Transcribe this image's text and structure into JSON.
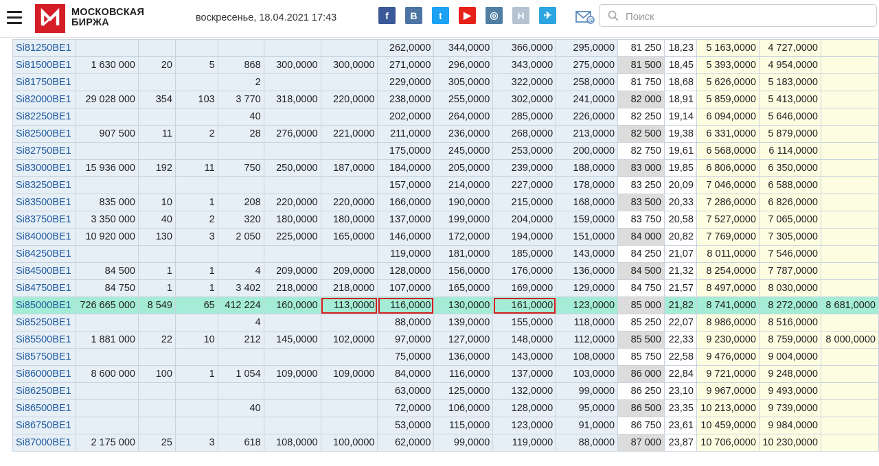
{
  "header": {
    "logo_text": "МОСКОВСКАЯ БИРЖА",
    "datetime": "воскресенье, 18.04.2021 17:43",
    "search_placeholder": "Поиск",
    "social": [
      {
        "name": "facebook-icon",
        "glyph": "f",
        "color": "#3b5998"
      },
      {
        "name": "vkontakte-icon",
        "glyph": "B",
        "color": "#4c75a3"
      },
      {
        "name": "twitter-icon",
        "glyph": "t",
        "color": "#1da1f2"
      },
      {
        "name": "youtube-icon",
        "glyph": "▶",
        "color": "#e62117"
      },
      {
        "name": "instagram-icon",
        "glyph": "◎",
        "color": "#517fa4"
      },
      {
        "name": "newsletter-h-icon",
        "glyph": "H",
        "color": "#b4c3cf"
      },
      {
        "name": "telegram-icon",
        "glyph": "✈",
        "color": "#2ca5e0"
      }
    ]
  },
  "table": {
    "rows": [
      {
        "c": [
          "Si81250BE1",
          "",
          "",
          "",
          "",
          "",
          "",
          "262,0000",
          "344,0000",
          "366,0000",
          "295,0000",
          "81 250",
          "18,23",
          "5 163,0000",
          "4 727,0000",
          ""
        ],
        "strong": false
      },
      {
        "c": [
          "Si81500BE1",
          "1 630 000",
          "20",
          "5",
          "868",
          "300,0000",
          "300,0000",
          "271,0000",
          "296,0000",
          "343,0000",
          "275,0000",
          "81 500",
          "18,45",
          "5 393,0000",
          "4 954,0000",
          ""
        ],
        "strong": true
      },
      {
        "c": [
          "Si81750BE1",
          "",
          "",
          "",
          "2",
          "",
          "",
          "229,0000",
          "305,0000",
          "322,0000",
          "258,0000",
          "81 750",
          "18,68",
          "5 626,0000",
          "5 183,0000",
          ""
        ],
        "strong": false
      },
      {
        "c": [
          "Si82000BE1",
          "29 028 000",
          "354",
          "103",
          "3 770",
          "318,0000",
          "220,0000",
          "238,0000",
          "255,0000",
          "302,0000",
          "241,0000",
          "82 000",
          "18,91",
          "5 859,0000",
          "5 413,0000",
          ""
        ],
        "strong": true
      },
      {
        "c": [
          "Si82250BE1",
          "",
          "",
          "",
          "40",
          "",
          "",
          "202,0000",
          "264,0000",
          "285,0000",
          "226,0000",
          "82 250",
          "19,14",
          "6 094,0000",
          "5 646,0000",
          ""
        ],
        "strong": false
      },
      {
        "c": [
          "Si82500BE1",
          "907 500",
          "11",
          "2",
          "28",
          "276,0000",
          "221,0000",
          "211,0000",
          "236,0000",
          "268,0000",
          "213,0000",
          "82 500",
          "19,38",
          "6 331,0000",
          "5 879,0000",
          ""
        ],
        "strong": true
      },
      {
        "c": [
          "Si82750BE1",
          "",
          "",
          "",
          "",
          "",
          "",
          "175,0000",
          "245,0000",
          "253,0000",
          "200,0000",
          "82 750",
          "19,61",
          "6 568,0000",
          "6 114,0000",
          ""
        ],
        "strong": false
      },
      {
        "c": [
          "Si83000BE1",
          "15 936 000",
          "192",
          "11",
          "750",
          "250,0000",
          "187,0000",
          "184,0000",
          "205,0000",
          "239,0000",
          "188,0000",
          "83 000",
          "19,85",
          "6 806,0000",
          "6 350,0000",
          ""
        ],
        "strong": true
      },
      {
        "c": [
          "Si83250BE1",
          "",
          "",
          "",
          "",
          "",
          "",
          "157,0000",
          "214,0000",
          "227,0000",
          "178,0000",
          "83 250",
          "20,09",
          "7 046,0000",
          "6 588,0000",
          ""
        ],
        "strong": false
      },
      {
        "c": [
          "Si83500BE1",
          "835 000",
          "10",
          "1",
          "208",
          "220,0000",
          "220,0000",
          "166,0000",
          "190,0000",
          "215,0000",
          "168,0000",
          "83 500",
          "20,33",
          "7 286,0000",
          "6 826,0000",
          ""
        ],
        "strong": true
      },
      {
        "c": [
          "Si83750BE1",
          "3 350 000",
          "40",
          "2",
          "320",
          "180,0000",
          "180,0000",
          "137,0000",
          "199,0000",
          "204,0000",
          "159,0000",
          "83 750",
          "20,58",
          "7 527,0000",
          "7 065,0000",
          ""
        ],
        "strong": false
      },
      {
        "c": [
          "Si84000BE1",
          "10 920 000",
          "130",
          "3",
          "2 050",
          "225,0000",
          "165,0000",
          "146,0000",
          "172,0000",
          "194,0000",
          "151,0000",
          "84 000",
          "20,82",
          "7 769,0000",
          "7 305,0000",
          ""
        ],
        "strong": true
      },
      {
        "c": [
          "Si84250BE1",
          "",
          "",
          "",
          "",
          "",
          "",
          "119,0000",
          "181,0000",
          "185,0000",
          "143,0000",
          "84 250",
          "21,07",
          "8 011,0000",
          "7 546,0000",
          ""
        ],
        "strong": false
      },
      {
        "c": [
          "Si84500BE1",
          "84 500",
          "1",
          "1",
          "4",
          "209,0000",
          "209,0000",
          "128,0000",
          "156,0000",
          "176,0000",
          "136,0000",
          "84 500",
          "21,32",
          "8 254,0000",
          "7 787,0000",
          ""
        ],
        "strong": true
      },
      {
        "c": [
          "Si84750BE1",
          "84 750",
          "1",
          "1",
          "3 402",
          "218,0000",
          "218,0000",
          "107,0000",
          "165,0000",
          "169,0000",
          "129,0000",
          "84 750",
          "21,57",
          "8 497,0000",
          "8 030,0000",
          ""
        ],
        "strong": false
      },
      {
        "c": [
          "Si85000BE1",
          "726 665 000",
          "8 549",
          "65",
          "412 224",
          "160,0000",
          "113,0000",
          "116,0000",
          "130,0000",
          "161,0000",
          "123,0000",
          "85 000",
          "21,82",
          "8 741,0000",
          "8 272,0000",
          "8 681,0000"
        ],
        "strong": true,
        "highlight": true,
        "boxed": [
          6,
          7,
          9
        ]
      },
      {
        "c": [
          "Si85250BE1",
          "",
          "",
          "",
          "4",
          "",
          "",
          "88,0000",
          "139,0000",
          "155,0000",
          "118,0000",
          "85 250",
          "22,07",
          "8 986,0000",
          "8 516,0000",
          ""
        ],
        "strong": false
      },
      {
        "c": [
          "Si85500BE1",
          "1 881 000",
          "22",
          "10",
          "212",
          "145,0000",
          "102,0000",
          "97,0000",
          "127,0000",
          "148,0000",
          "112,0000",
          "85 500",
          "22,33",
          "9 230,0000",
          "8 759,0000",
          "8 000,0000"
        ],
        "strong": true
      },
      {
        "c": [
          "Si85750BE1",
          "",
          "",
          "",
          "",
          "",
          "",
          "75,0000",
          "136,0000",
          "143,0000",
          "108,0000",
          "85 750",
          "22,58",
          "9 476,0000",
          "9 004,0000",
          ""
        ],
        "strong": false
      },
      {
        "c": [
          "Si86000BE1",
          "8 600 000",
          "100",
          "1",
          "1 054",
          "109,0000",
          "109,0000",
          "84,0000",
          "116,0000",
          "137,0000",
          "103,0000",
          "86 000",
          "22,84",
          "9 721,0000",
          "9 248,0000",
          ""
        ],
        "strong": true
      },
      {
        "c": [
          "Si86250BE1",
          "",
          "",
          "",
          "",
          "",
          "",
          "63,0000",
          "125,0000",
          "132,0000",
          "99,0000",
          "86 250",
          "23,10",
          "9 967,0000",
          "9 493,0000",
          ""
        ],
        "strong": false
      },
      {
        "c": [
          "Si86500BE1",
          "",
          "",
          "",
          "40",
          "",
          "",
          "72,0000",
          "106,0000",
          "128,0000",
          "95,0000",
          "86 500",
          "23,35",
          "10 213,0000",
          "9 739,0000",
          ""
        ],
        "strong": true
      },
      {
        "c": [
          "Si86750BE1",
          "",
          "",
          "",
          "",
          "",
          "",
          "53,0000",
          "115,0000",
          "123,0000",
          "91,0000",
          "86 750",
          "23,61",
          "10 459,0000",
          "9 984,0000",
          ""
        ],
        "strong": false
      },
      {
        "c": [
          "Si87000BE1",
          "2 175 000",
          "25",
          "3",
          "618",
          "108,0000",
          "100,0000",
          "62,0000",
          "99,0000",
          "119,0000",
          "88,0000",
          "87 000",
          "23,87",
          "10 706,0000",
          "10 230,0000",
          ""
        ],
        "strong": true
      }
    ]
  }
}
